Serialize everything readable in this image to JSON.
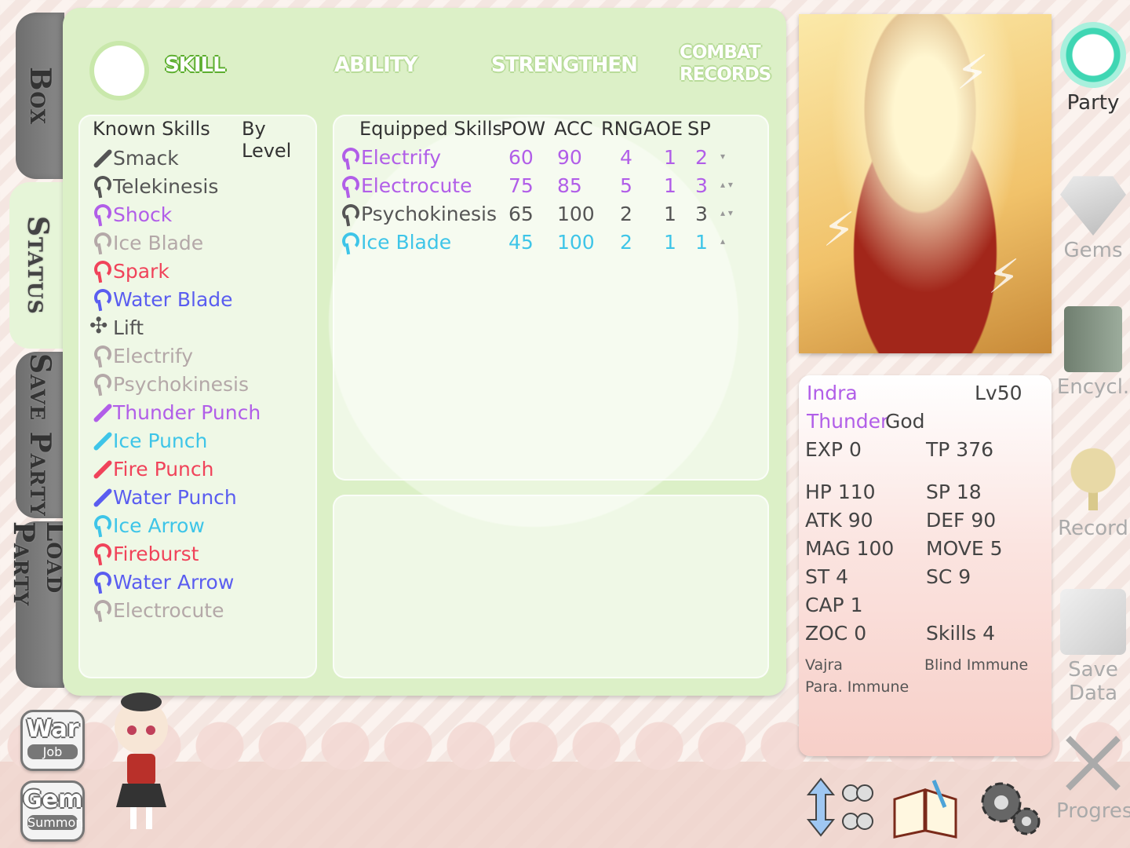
{
  "left_tabs": {
    "box": "Box",
    "status": "Status",
    "save_party": "Save Party",
    "load_party": "Load Party"
  },
  "top_tabs": {
    "skill": "SKILL",
    "ability": "ABILITY",
    "strengthen": "STRENGTHEN",
    "combat_records_1": "COMBAT",
    "combat_records_2": "RECORDS"
  },
  "known_skills": {
    "header": "Known Skills",
    "sort_label": "By Level",
    "items": [
      {
        "name": "Smack",
        "color": "#555555",
        "icon": "sword-icon"
      },
      {
        "name": "Telekinesis",
        "color": "#555555",
        "icon": "wand-icon"
      },
      {
        "name": "Shock",
        "color": "#b15ee8",
        "icon": "wand-icon"
      },
      {
        "name": "Ice Blade",
        "color": "#b4a8a8",
        "icon": "wand-icon"
      },
      {
        "name": "Spark",
        "color": "#f0435a",
        "icon": "wand-icon"
      },
      {
        "name": "Water Blade",
        "color": "#5a5df0",
        "icon": "wand-icon"
      },
      {
        "name": "Lift",
        "color": "#555555",
        "icon": "fan-icon"
      },
      {
        "name": "Electrify",
        "color": "#b4a8a8",
        "icon": "wand-icon"
      },
      {
        "name": "Psychokinesis",
        "color": "#b4a8a8",
        "icon": "wand-icon"
      },
      {
        "name": "Thunder Punch",
        "color": "#b15ee8",
        "icon": "sword-icon"
      },
      {
        "name": "Ice Punch",
        "color": "#3ec5e8",
        "icon": "sword-icon"
      },
      {
        "name": "Fire Punch",
        "color": "#f0435a",
        "icon": "sword-icon"
      },
      {
        "name": "Water Punch",
        "color": "#5a5df0",
        "icon": "sword-icon"
      },
      {
        "name": "Ice Arrow",
        "color": "#3ec5e8",
        "icon": "wand-icon"
      },
      {
        "name": "Fireburst",
        "color": "#f0435a",
        "icon": "wand-icon"
      },
      {
        "name": "Water Arrow",
        "color": "#5a5df0",
        "icon": "wand-icon"
      },
      {
        "name": "Electrocute",
        "color": "#b4a8a8",
        "icon": "wand-icon"
      }
    ]
  },
  "equipped_skills": {
    "headers": {
      "name": "Equipped Skills",
      "pow": "POW",
      "acc": "ACC",
      "rng": "RNG",
      "aoe": "AOE",
      "sp": "SP"
    },
    "rows": [
      {
        "name": "Electrify",
        "pow": "60",
        "acc": "90",
        "rng": "4",
        "aoe": "1",
        "sp": "2",
        "color": "#b15ee8",
        "arrows": "▾"
      },
      {
        "name": "Electrocute",
        "pow": "75",
        "acc": "85",
        "rng": "5",
        "aoe": "1",
        "sp": "3",
        "color": "#b15ee8",
        "arrows": "▴ ▾"
      },
      {
        "name": "Psychokinesis",
        "pow": "65",
        "acc": "100",
        "rng": "2",
        "aoe": "1",
        "sp": "3",
        "color": "#555555",
        "arrows": "▴ ▾"
      },
      {
        "name": "Ice Blade",
        "pow": "45",
        "acc": "100",
        "rng": "2",
        "aoe": "1",
        "sp": "1",
        "color": "#3ec5e8",
        "arrows": "▴"
      }
    ]
  },
  "character": {
    "name": "Indra",
    "level": "Lv50",
    "title_1": "Thunder",
    "title_2": "God",
    "exp": "EXP 0",
    "tp": "TP 376",
    "hp": "HP 110",
    "sp": "SP 18",
    "atk": "ATK 90",
    "def": "DEF 90",
    "mag": "MAG 100",
    "move": "MOVE 5",
    "st": "ST 4",
    "sc": "SC 9",
    "cap": "CAP 1",
    "zoc": "ZOC 0",
    "skills": "Skills 4",
    "passive_1": "Vajra",
    "passive_2": "Blind Immune",
    "passive_3": "Para. Immune"
  },
  "right_menu": {
    "party": "Party",
    "gems": "Gems",
    "encyclopedia": "Encycl.",
    "record": "Record",
    "save_data": "Save Data",
    "progress": "Progress"
  },
  "bubbles": {
    "war": "War",
    "job": "Job",
    "gem": "Gem",
    "summon": "Summon"
  },
  "colors": {
    "purple": "#b15ee8",
    "cyan": "#3ec5e8",
    "panel_green": "#dcf0c7"
  }
}
